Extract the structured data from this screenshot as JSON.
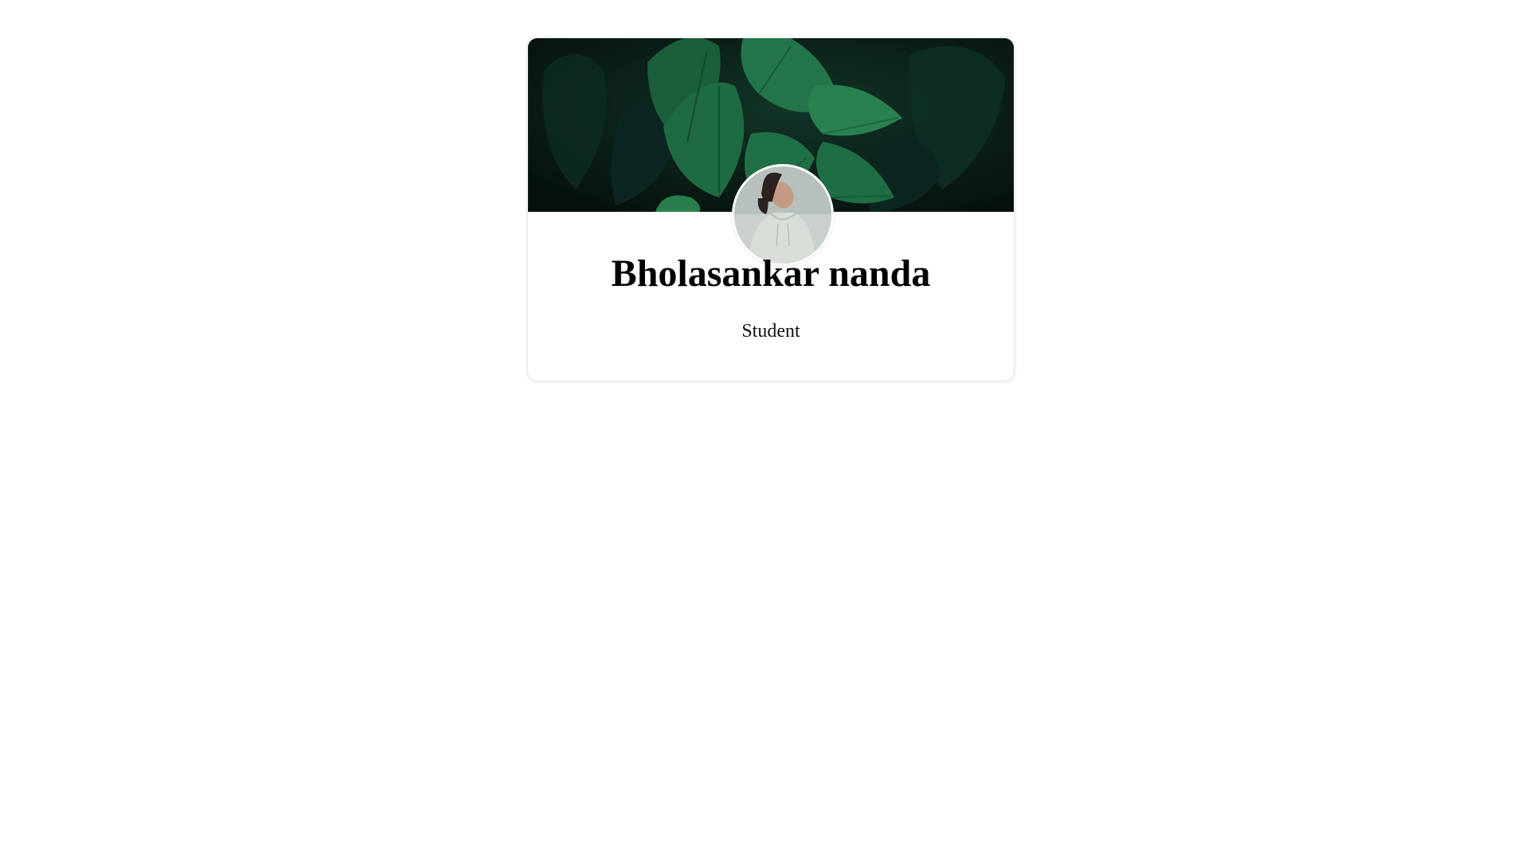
{
  "profile": {
    "name": "Bholasankar nanda",
    "role": "Student"
  },
  "cover": {
    "subject": "green-leaves-photo",
    "colors": {
      "background": "#0a1a16",
      "leaf_dark": "#0f3b2a",
      "leaf": "#1d6a3f",
      "leaf_light": "#2e8a52"
    }
  },
  "avatar": {
    "subject": "person-in-hoodie-photo",
    "colors": {
      "background": "#c9d0cd",
      "hoodie": "#d9ddd8",
      "hair": "#2b2220",
      "skin": "#c49a84"
    }
  }
}
